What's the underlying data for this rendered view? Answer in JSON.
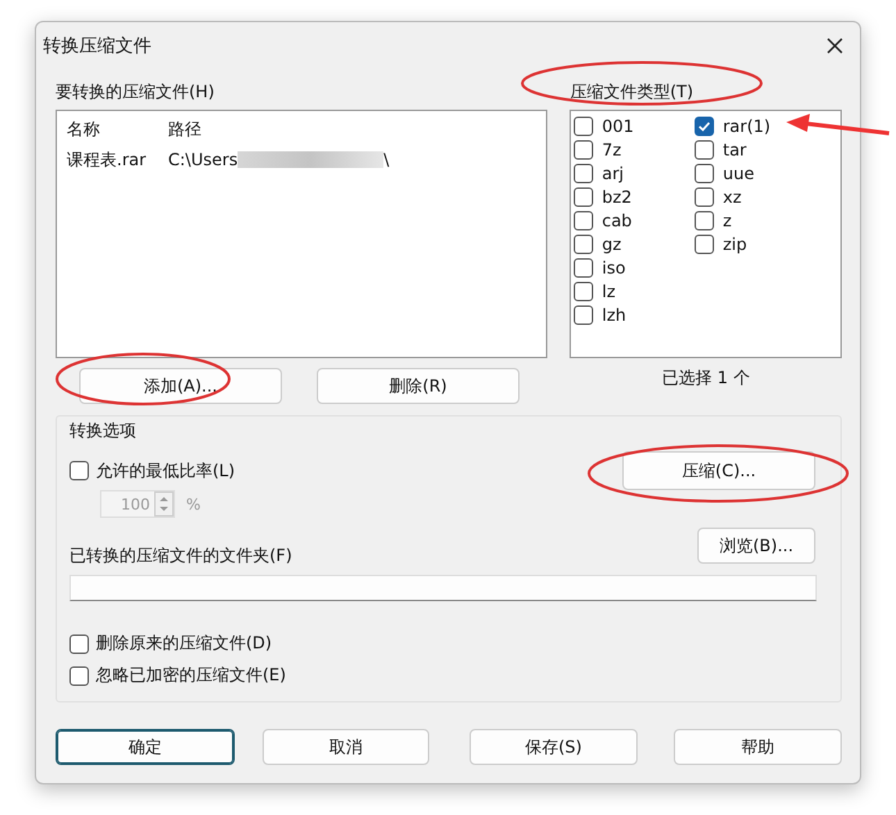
{
  "window": {
    "title": "转换压缩文件"
  },
  "archives": {
    "label": "要转换的压缩文件(H)",
    "columns": [
      "名称",
      "路径"
    ],
    "rows": [
      {
        "name": "课程表.rar",
        "path_start": "C:\\Users",
        "path_end": "\\"
      }
    ],
    "buttons": [
      "添加(A)...",
      "删除(R)"
    ]
  },
  "types": {
    "label": "压缩文件类型(T)",
    "items": [
      {
        "label": "001",
        "checked": false
      },
      {
        "label": "7z",
        "checked": false
      },
      {
        "label": "arj",
        "checked": false
      },
      {
        "label": "bz2",
        "checked": false
      },
      {
        "label": "cab",
        "checked": false
      },
      {
        "label": "gz",
        "checked": false
      },
      {
        "label": "iso",
        "checked": false
      },
      {
        "label": "lz",
        "checked": false
      },
      {
        "label": "lzh",
        "checked": false
      },
      {
        "label": "rar(1)",
        "checked": true
      },
      {
        "label": "tar",
        "checked": false
      },
      {
        "label": "uue",
        "checked": false
      },
      {
        "label": "xz",
        "checked": false
      },
      {
        "label": "z",
        "checked": false
      },
      {
        "label": "zip",
        "checked": false
      }
    ],
    "status": "已选择 1 个"
  },
  "options": {
    "title": "转换选项",
    "min_ratio": {
      "label": "允许的最低比率(L)",
      "checked": false
    },
    "ratio": {
      "value": "100",
      "unit": "%",
      "disabled": true
    },
    "compress_button": "压缩(C)...",
    "folder": {
      "label": "已转换的压缩文件的文件夹(F)",
      "browse_button": "浏览(B)..."
    },
    "checkboxes": [
      {
        "label": "删除原来的压缩文件(D)",
        "checked": false
      },
      {
        "label": "忽略已加密的压缩文件(E)",
        "checked": false
      }
    ]
  },
  "buttons": [
    {
      "label": "确定",
      "focused": true
    },
    {
      "label": "取消",
      "focused": false
    },
    {
      "label": "保存(S)",
      "focused": false
    },
    {
      "label": "帮助",
      "focused": false
    }
  ]
}
